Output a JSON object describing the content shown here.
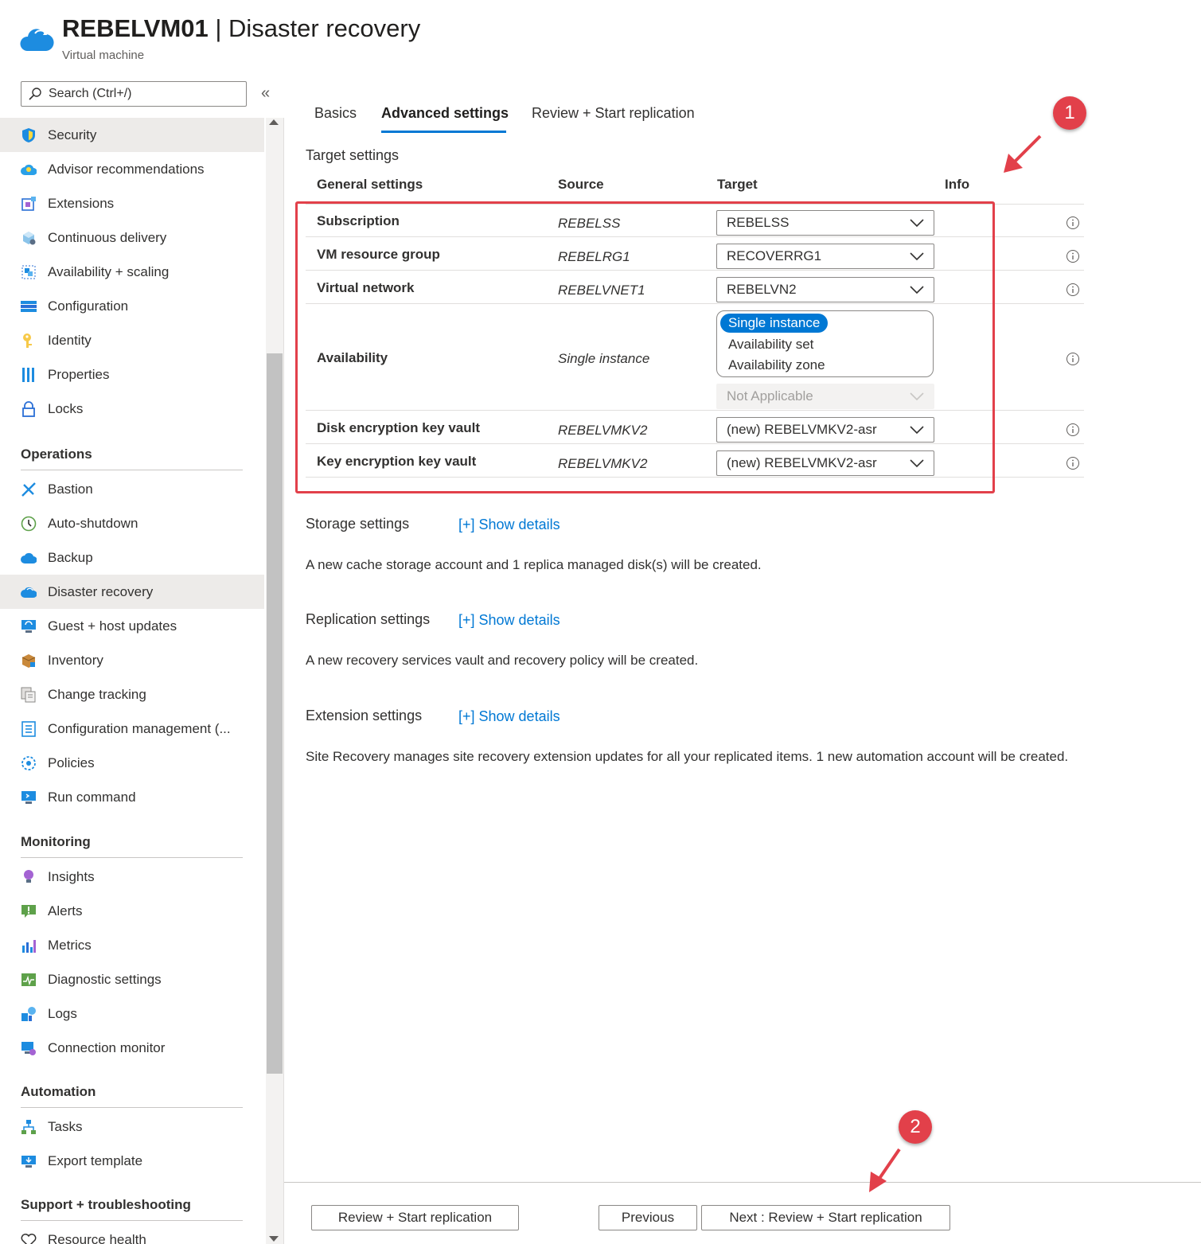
{
  "header": {
    "resource_name": "REBELVM01",
    "separator": " | ",
    "page_name": "Disaster recovery",
    "subtitle": "Virtual machine"
  },
  "sidebar": {
    "search_placeholder": "Search (Ctrl+/)",
    "collapse_glyph": "«",
    "items": [
      {
        "label": "Security",
        "icon": "shield-icon",
        "selected": false
      },
      {
        "label": "Advisor recommendations",
        "icon": "advisor-icon",
        "selected": false
      },
      {
        "label": "Extensions",
        "icon": "extensions-icon",
        "selected": false
      },
      {
        "label": "Continuous delivery",
        "icon": "continuous-delivery-icon",
        "selected": false
      },
      {
        "label": "Availability + scaling",
        "icon": "availability-scaling-icon",
        "selected": false
      },
      {
        "label": "Configuration",
        "icon": "configuration-icon",
        "selected": false
      },
      {
        "label": "Identity",
        "icon": "identity-key-icon",
        "selected": false
      },
      {
        "label": "Properties",
        "icon": "properties-icon",
        "selected": false
      },
      {
        "label": "Locks",
        "icon": "lock-icon",
        "selected": false
      }
    ],
    "sections": [
      {
        "title": "Operations",
        "items": [
          {
            "label": "Bastion",
            "icon": "bastion-icon"
          },
          {
            "label": "Auto-shutdown",
            "icon": "clock-icon"
          },
          {
            "label": "Backup",
            "icon": "backup-cloud-icon"
          },
          {
            "label": "Disaster recovery",
            "icon": "disaster-recovery-cloud-icon",
            "selected": true
          },
          {
            "label": "Guest + host updates",
            "icon": "updates-icon"
          },
          {
            "label": "Inventory",
            "icon": "inventory-box-icon"
          },
          {
            "label": "Change tracking",
            "icon": "change-tracking-icon"
          },
          {
            "label": "Configuration management (...",
            "icon": "config-management-icon"
          },
          {
            "label": "Policies",
            "icon": "policies-icon"
          },
          {
            "label": "Run command",
            "icon": "run-command-icon"
          }
        ]
      },
      {
        "title": "Monitoring",
        "items": [
          {
            "label": "Insights",
            "icon": "insights-bulb-icon"
          },
          {
            "label": "Alerts",
            "icon": "alerts-icon"
          },
          {
            "label": "Metrics",
            "icon": "metrics-chart-icon"
          },
          {
            "label": "Diagnostic settings",
            "icon": "diagnostic-icon"
          },
          {
            "label": "Logs",
            "icon": "logs-icon"
          },
          {
            "label": "Connection monitor",
            "icon": "connection-monitor-icon"
          }
        ]
      },
      {
        "title": "Automation",
        "items": [
          {
            "label": "Tasks",
            "icon": "tasks-icon"
          },
          {
            "label": "Export template",
            "icon": "export-template-icon"
          }
        ]
      },
      {
        "title": "Support + troubleshooting",
        "items": [
          {
            "label": "Resource health",
            "icon": "heart-icon"
          }
        ]
      }
    ]
  },
  "tabs": [
    {
      "label": "Basics",
      "active": false
    },
    {
      "label": "Advanced settings",
      "active": true
    },
    {
      "label": "Review + Start replication",
      "active": false
    }
  ],
  "target_settings": {
    "title": "Target settings",
    "columns": [
      "General settings",
      "Source",
      "Target",
      "Info"
    ],
    "rows": [
      {
        "label": "Subscription",
        "source": "REBELSS",
        "target": "REBELSS"
      },
      {
        "label": "VM resource group",
        "source": "REBELRG1",
        "target": "RECOVERRG1"
      },
      {
        "label": "Virtual network",
        "source": "REBELVNET1",
        "target": "REBELVN2"
      },
      {
        "label": "Availability",
        "source": "Single instance",
        "options": [
          "Single instance",
          "Availability set",
          "Availability zone"
        ],
        "selected_option": "Single instance",
        "secondary_target": "Not Applicable"
      },
      {
        "label": "Disk encryption key vault",
        "source": "REBELVMKV2",
        "target": "(new) REBELVMKV2-asr"
      },
      {
        "label": "Key encryption key vault",
        "source": "REBELVMKV2",
        "target": "(new) REBELVMKV2-asr"
      }
    ]
  },
  "storage": {
    "title": "Storage settings",
    "link": "[+] Show details",
    "description": "A new cache storage account and 1 replica managed disk(s) will be created."
  },
  "replication": {
    "title": "Replication settings",
    "link": "[+] Show details",
    "description": "A new recovery services vault and recovery policy will be created."
  },
  "extension": {
    "title": "Extension settings",
    "link": "[+] Show details",
    "description": "Site Recovery manages site recovery extension updates for all your replicated items. 1 new automation account will be created."
  },
  "footer": {
    "review_button": "Review + Start replication",
    "previous_button": "Previous",
    "next_button": "Next : Review + Start replication"
  },
  "callouts": [
    "1",
    "2"
  ],
  "colors": {
    "accent": "#0078d4",
    "callout": "#e2404a",
    "selected_nav": "#edebe9"
  }
}
